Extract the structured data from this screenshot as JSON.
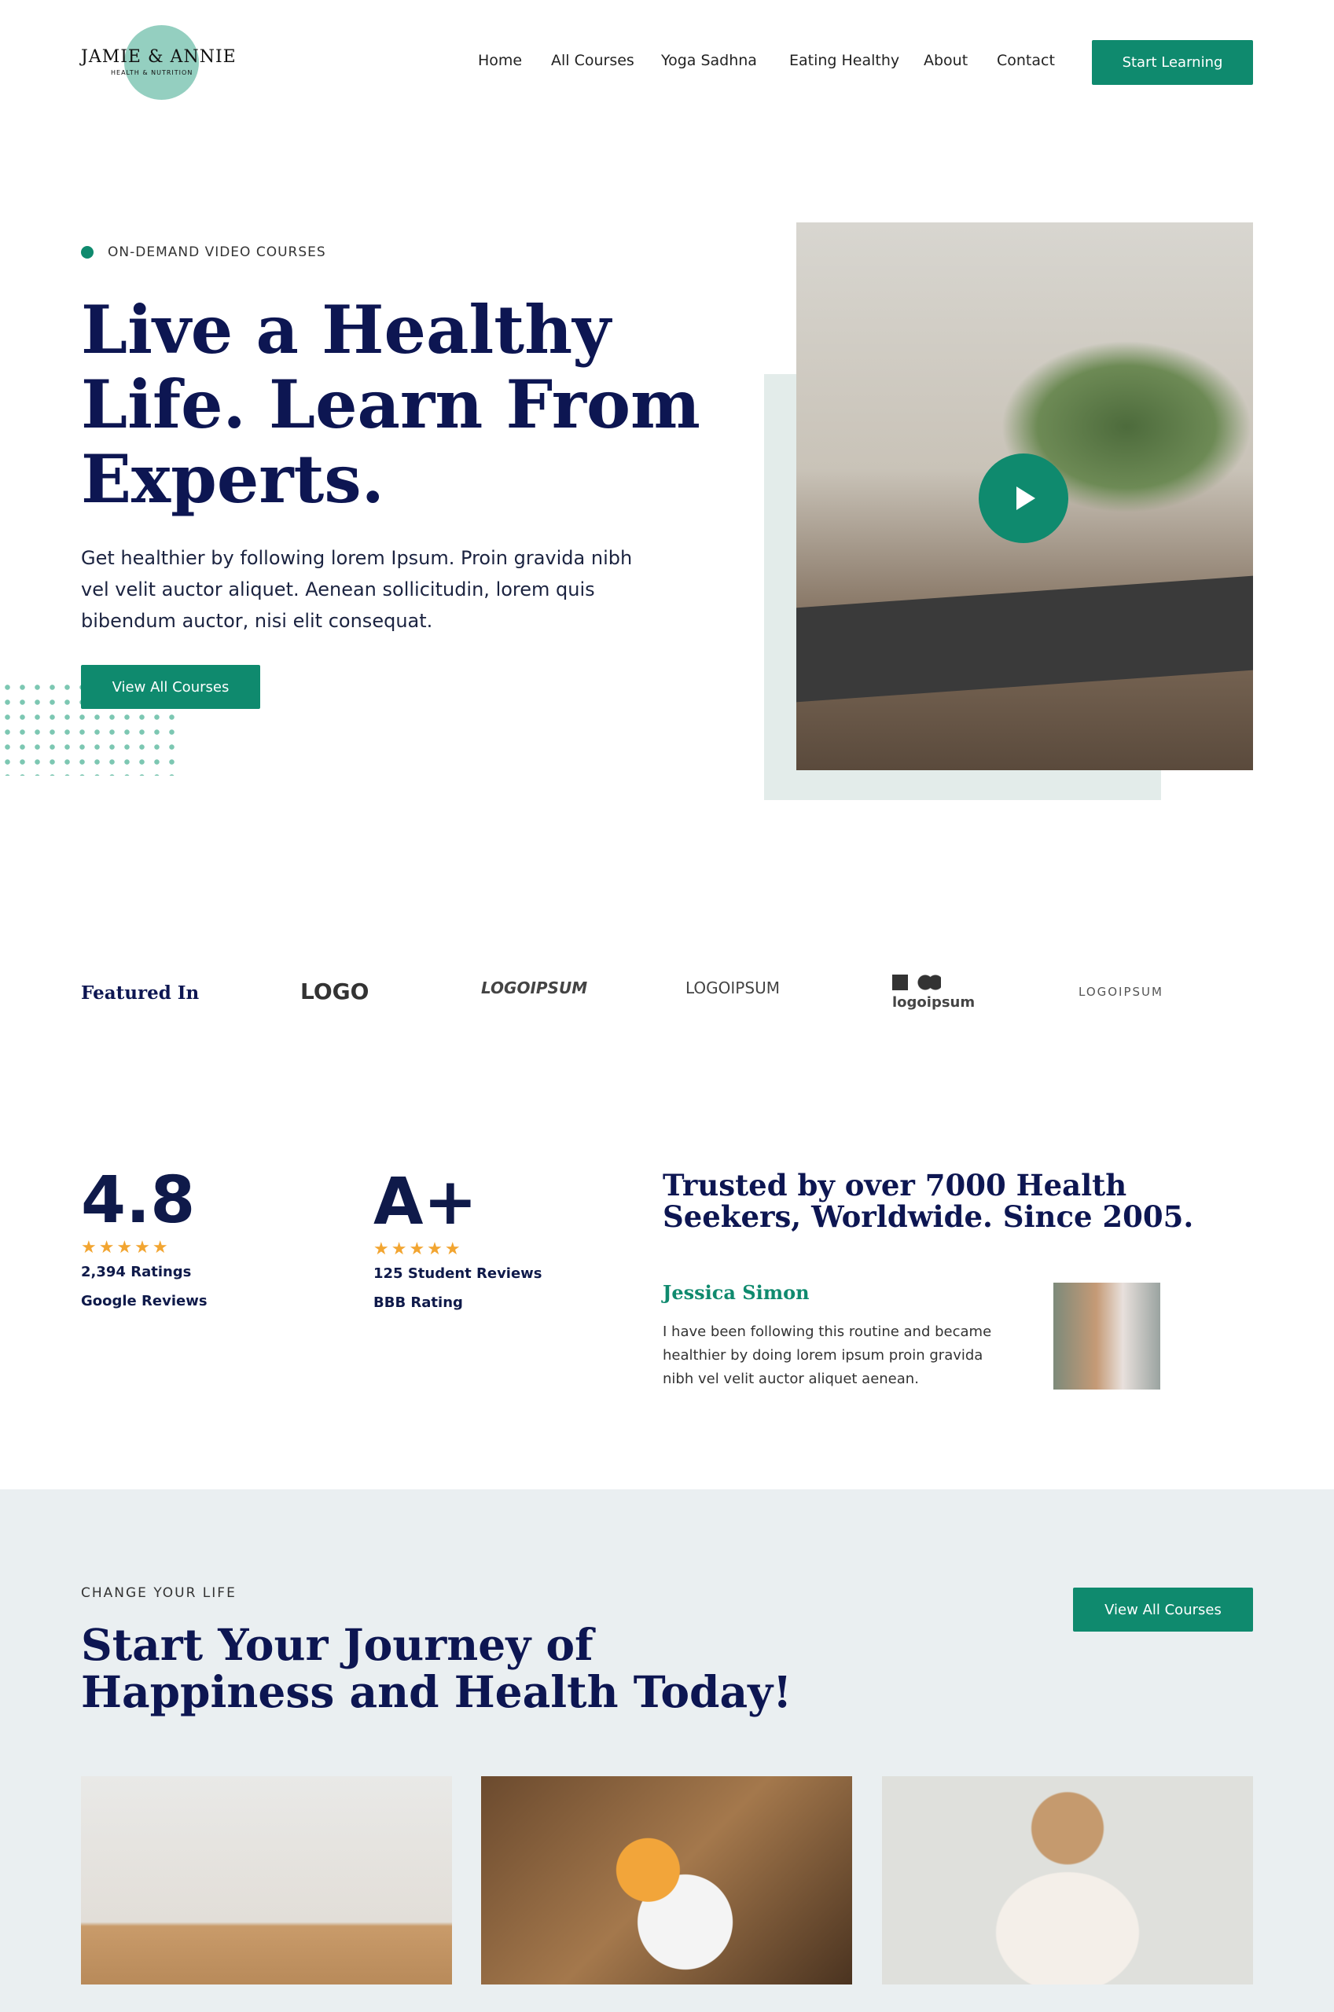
{
  "header": {
    "logo_title": "JAMIE & ANNIE",
    "logo_subtitle": "HEALTH & NUTRITION",
    "nav": [
      "Home",
      "All Courses",
      "Yoga Sadhna",
      "Eating Healthy",
      "About",
      "Contact"
    ],
    "cta": "Start Learning"
  },
  "hero": {
    "tag": "ON-DEMAND VIDEO COURSES",
    "title_lines": [
      "Live a Healthy",
      "Life. Learn From",
      "Experts."
    ],
    "description": "Get healthier by following lorem Ipsum. Proin gravida nibh vel velit auctor aliquet. Aenean sollicitudin, lorem quis bibendum auctor, nisi elit consequat.",
    "button": "View All Courses"
  },
  "featured": {
    "label": "Featured In",
    "logos": [
      "LOGO",
      "LOGOIPSUM",
      "LOGOIPSUM",
      "logoipsum",
      "LOGOIPSUM"
    ]
  },
  "stats": [
    {
      "value": "4.8",
      "stars": 5,
      "line1": "2,394 Ratings",
      "line2": "Google Reviews"
    },
    {
      "value": "A+",
      "stars": 5,
      "line1": "125 Student Reviews",
      "line2": "BBB Rating"
    }
  ],
  "testimonial": {
    "heading": "Trusted by over 7000 Health Seekers, Worldwide. Since 2005.",
    "name": "Jessica Simon",
    "quote": "I have been following this routine and became healthier by doing lorem ipsum proin gravida nibh vel velit auctor aliquet aenean."
  },
  "journey": {
    "eyebrow": "CHANGE YOUR LIFE",
    "title_lines": [
      "Start Your Journey of",
      "Happiness and Health Today!"
    ],
    "button": "View All Courses"
  },
  "colors": {
    "accent": "#0f8a6e",
    "navy": "#0d1652",
    "section_bg": "#eaeff1"
  }
}
